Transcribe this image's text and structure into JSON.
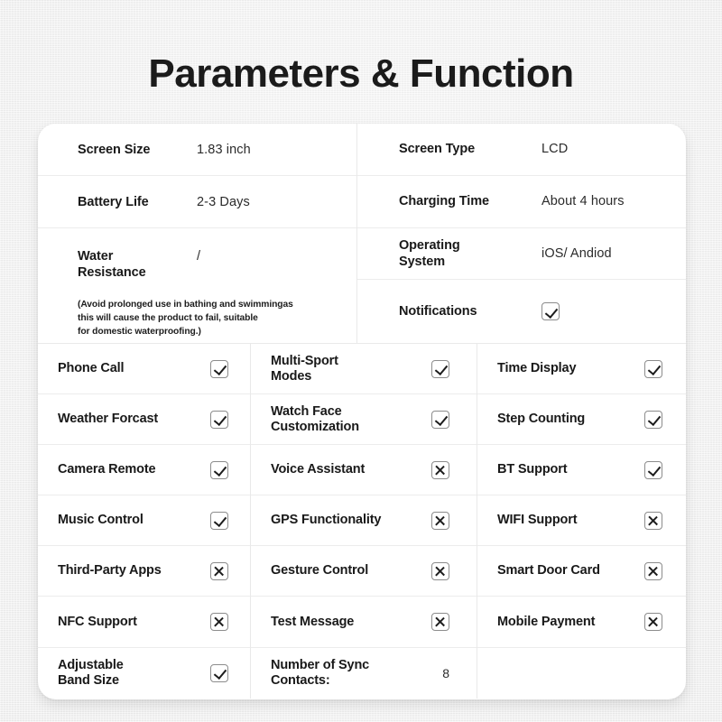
{
  "page": {
    "title": "Parameters & Function"
  },
  "specs": {
    "left": [
      {
        "label": "Screen Size",
        "value": "1.83 inch"
      },
      {
        "label": "Battery Life",
        "value": "2-3 Days"
      },
      {
        "label": "Water\nResistance",
        "value": "/",
        "note": "(Avoid prolonged use in bathing and swimmingas\nthis will cause the product to fail, suitable\nfor domestic waterproofing.)"
      }
    ],
    "right": [
      {
        "label": "Screen Type",
        "value": "LCD"
      },
      {
        "label": "Charging Time",
        "value": "About 4 hours"
      },
      {
        "label": "Operating\nSystem",
        "value": "iOS/ Andiod"
      },
      {
        "label": "Notifications",
        "mark": "check"
      }
    ]
  },
  "features": {
    "col1": [
      {
        "label": "Phone Call",
        "mark": "check"
      },
      {
        "label": "Weather Forcast",
        "mark": "check"
      },
      {
        "label": "Camera Remote",
        "mark": "check"
      },
      {
        "label": "Music Control",
        "mark": "check"
      },
      {
        "label": "Third-Party Apps",
        "mark": "cross"
      },
      {
        "label": "NFC Support",
        "mark": "cross"
      },
      {
        "label": "Adjustable\nBand Size",
        "mark": "check"
      }
    ],
    "col2": [
      {
        "label": "Multi-Sport\nModes",
        "mark": "check"
      },
      {
        "label": "Watch Face\nCustomization",
        "mark": "check"
      },
      {
        "label": "Voice Assistant",
        "mark": "cross"
      },
      {
        "label": "GPS Functionality",
        "mark": "cross"
      },
      {
        "label": "Gesture Control",
        "mark": "cross"
      },
      {
        "label": "Test Message",
        "mark": "cross"
      },
      {
        "label": "Number of Sync\nContacts:",
        "value": "8"
      }
    ],
    "col3": [
      {
        "label": "Time Display",
        "mark": "check"
      },
      {
        "label": "Step Counting",
        "mark": "check"
      },
      {
        "label": "BT Support",
        "mark": "check"
      },
      {
        "label": "WIFI Support",
        "mark": "cross"
      },
      {
        "label": "Smart Door Card",
        "mark": "cross"
      },
      {
        "label": "Mobile Payment",
        "mark": "cross"
      },
      {
        "label": "",
        "mark": ""
      }
    ]
  },
  "colors": {
    "background": "#f1f1f1",
    "card": "#ffffff",
    "text": "#191919",
    "divider": "#ececec"
  }
}
